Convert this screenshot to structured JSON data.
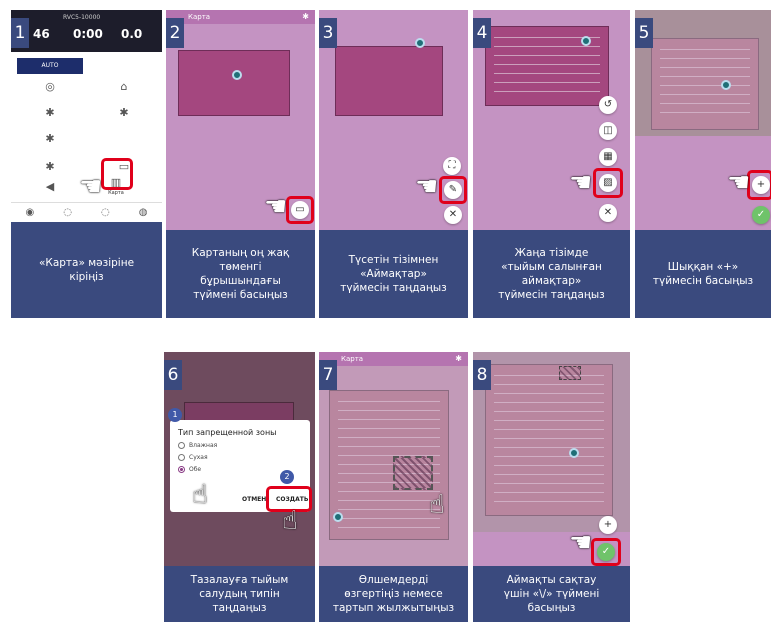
{
  "panels": [
    {
      "step": "1",
      "caption": "«Карта» мәзіріне\nкіріңіз"
    },
    {
      "step": "2",
      "caption": "Картаның оң жақ\nтөменгі\nбұрышындағы\nтүймені басыңыз"
    },
    {
      "step": "3",
      "caption": "Түсетін тізімнен\n«Аймақтар»\nтүймесін таңдаңыз"
    },
    {
      "step": "4",
      "caption": "Жаңа тізімде\n«тыйым салынған\nаймақтар»\nтүймесін таңдаңыз"
    },
    {
      "step": "5",
      "caption": "Шыққан «+»\nтүймесін басыңыз"
    },
    {
      "step": "6",
      "caption": "Тазалауға тыйым\nсалудың типін\nтаңдаңыз"
    },
    {
      "step": "7",
      "caption": "Өлшемдерді\nөзгертіңіз немесе\nтартып жылжытыңыз"
    },
    {
      "step": "8",
      "caption": "Аймақты сақтау\nүшін «\\/» түймені\nбасыңыз"
    }
  ],
  "app": {
    "battery": "46",
    "time": "0:00",
    "area": "0.0",
    "mode_label": "AUTO",
    "map_label": "Карта"
  },
  "map_header": "Карта",
  "dialog": {
    "title": "Тип запрещенной зоны",
    "options": [
      "Влажная",
      "Сухая",
      "Обе"
    ],
    "cancel": "ОТМЕН",
    "create": "СОЗДАТЬ",
    "badge1": "1",
    "badge2": "2"
  },
  "colors": {
    "caption_bg": "#3a4a7e",
    "highlight": "#e0001b",
    "confirm": "#6fc36a"
  }
}
